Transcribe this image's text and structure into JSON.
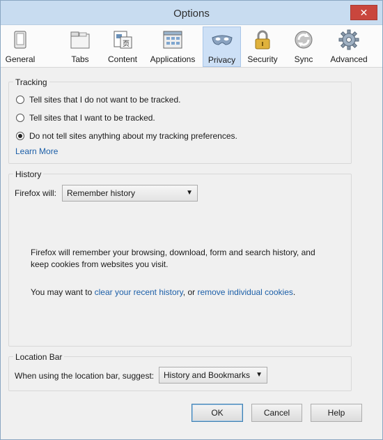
{
  "window": {
    "title": "Options",
    "close_glyph": "✕"
  },
  "tabs": [
    {
      "label": "General",
      "icon": "general-icon"
    },
    {
      "label": "Tabs",
      "icon": "tabs-icon"
    },
    {
      "label": "Content",
      "icon": "content-icon"
    },
    {
      "label": "Applications",
      "icon": "applications-icon"
    },
    {
      "label": "Privacy",
      "icon": "privacy-mask-icon",
      "selected": true
    },
    {
      "label": "Security",
      "icon": "padlock-icon"
    },
    {
      "label": "Sync",
      "icon": "sync-icon"
    },
    {
      "label": "Advanced",
      "icon": "gear-icon"
    }
  ],
  "tracking": {
    "legend": "Tracking",
    "options": [
      {
        "label": "Tell sites that I do not want to be tracked.",
        "checked": false
      },
      {
        "label": "Tell sites that I want to be tracked.",
        "checked": false
      },
      {
        "label": "Do not tell sites anything about my tracking preferences.",
        "checked": true
      }
    ],
    "learn_more": "Learn More"
  },
  "history": {
    "legend": "History",
    "firefox_will_label": "Firefox will:",
    "mode_value": "Remember history",
    "description": "Firefox will remember your browsing, download, form and search history, and keep cookies from websites you visit.",
    "prefix": "You may want to ",
    "clear_link": "clear your recent history",
    "middle": ", or ",
    "cookies_link": "remove individual cookies",
    "suffix": "."
  },
  "location_bar": {
    "legend": "Location Bar",
    "suggest_label": "When using the location bar, suggest:",
    "suggest_value": "History and Bookmarks"
  },
  "buttons": {
    "ok": "OK",
    "cancel": "Cancel",
    "help": "Help"
  },
  "colors": {
    "link": "#1c5fa8",
    "selected_tab": "#cde0f6",
    "close_button": "#c9463d"
  }
}
